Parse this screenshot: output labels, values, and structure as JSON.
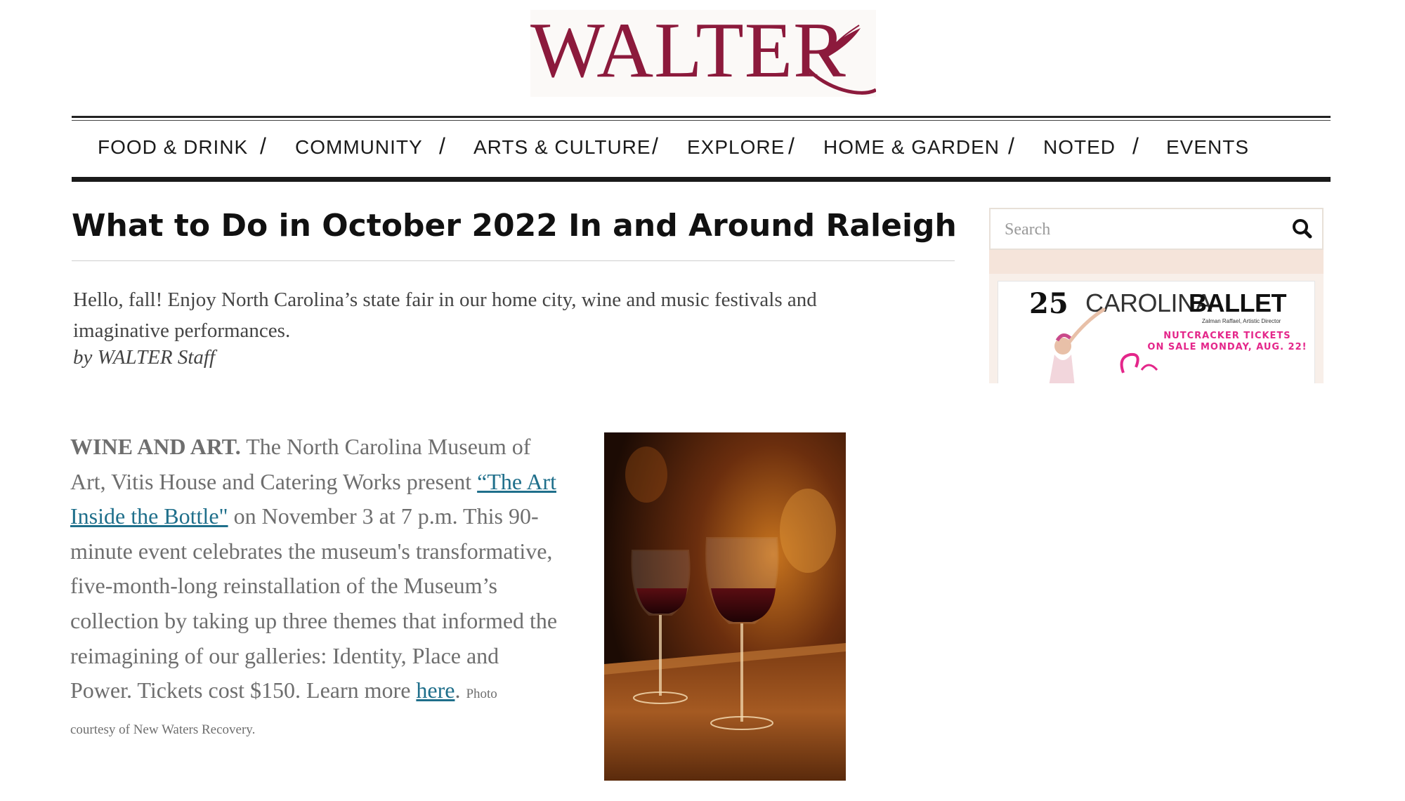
{
  "site": {
    "logo_text": "WALTER",
    "brand_color": "#8c1a3c"
  },
  "nav": {
    "items": [
      "FOOD & DRINK",
      "COMMUNITY",
      "ARTS & CULTURE",
      "EXPLORE",
      "HOME & GARDEN",
      "NOTED",
      "EVENTS"
    ],
    "separator": "/"
  },
  "article": {
    "title": "What to Do in October 2022 In and Around Raleigh",
    "intro": "Hello, fall! Enjoy North Carolina’s state fair in our home city, wine and music festivals and imaginative performances.",
    "byline": "by WALTER Staff",
    "section": {
      "lead": "WINE AND ART.",
      "text_1": " The North Carolina Museum of Art, Vitis House and Catering Works present ",
      "link_1": "“The Art Inside the Bottle\"",
      "text_2": " on November 3 at 7 p.m. This 90-minute event celebrates the museum's transformative, five-month-long reinstallation of the Museum’s collection by taking up three themes that informed the reimagining of our galleries: Identity, Place and Power. Tickets cost $150. Learn more ",
      "link_2": "here",
      "text_3": ".",
      "caption_1": "Photo",
      "caption_2": "courtesy of New Waters Recovery."
    },
    "link_color": "#1f6f8b"
  },
  "sidebar": {
    "search": {
      "placeholder": "Search"
    },
    "ad": {
      "anniversary": "25",
      "brand_light": "CAROLINA",
      "brand_bold": "BALLET",
      "director": "Zalman Raffael, Artistic Director",
      "tickets_line_1": "NUTCRACKER TICKETS",
      "tickets_line_2": "ON SALE MONDAY, AUG. 22!",
      "accent_color": "#e4268a"
    }
  }
}
